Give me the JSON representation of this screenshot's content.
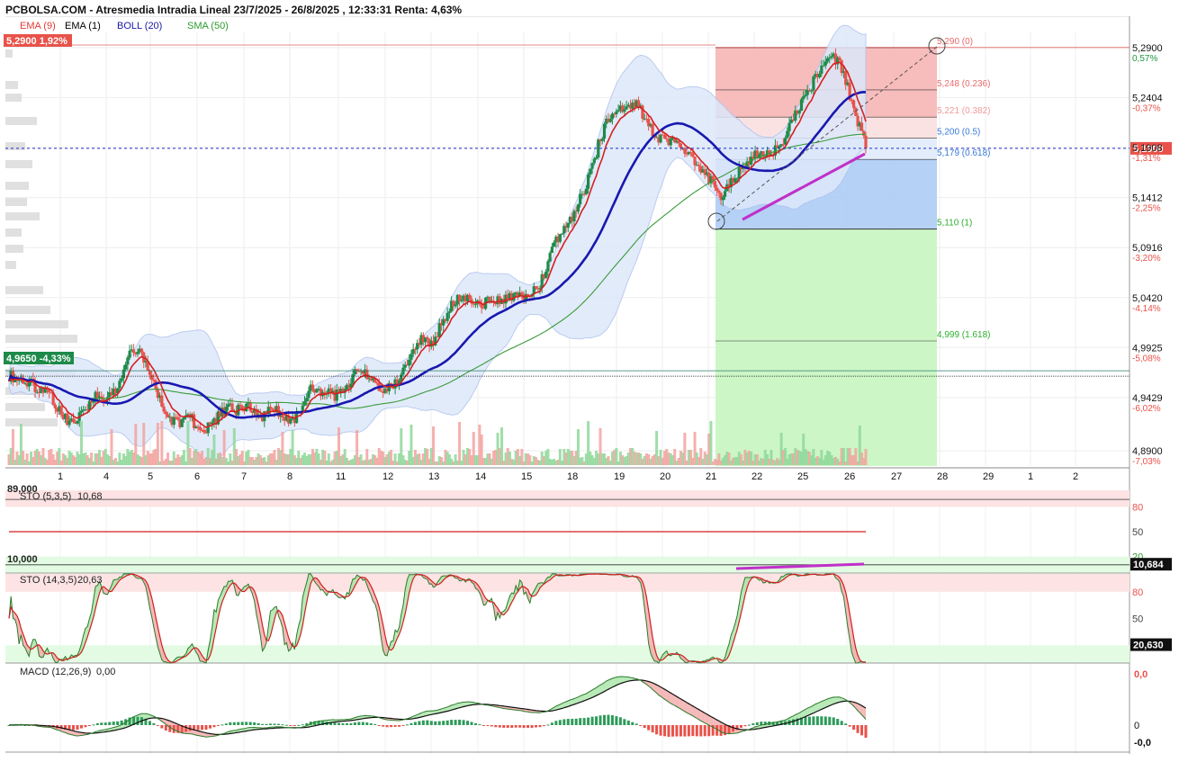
{
  "header": {
    "title": "PCBOLSA.COM - Atresmedia Intradia Lineal 23/7/2025 - 26/8/2025 , 12:33:31 Renta: 4,63%"
  },
  "legend": [
    {
      "label": "EMA (9)",
      "color": "#e53935"
    },
    {
      "label": "EMA (1)",
      "color": "#000000"
    },
    {
      "label": "BOLL (20)",
      "color": "#1a1aa8"
    },
    {
      "label": "SMA (50)",
      "color": "#2e9b2e"
    }
  ],
  "colors": {
    "up": "#1e8a4a",
    "down": "#e8524a",
    "ema9": "#d62020",
    "boll_mid": "#1818b0",
    "boll_band_fill": "#dde8fa",
    "sma50": "#3a9b3a",
    "fib_red": "#f6b5b5",
    "fib_blue": "#a8c9f5",
    "fib_green": "#c6f5c0",
    "trend_magenta": "#c030c8"
  },
  "price_badges": {
    "top": {
      "text": "5,2900 1,92%",
      "color": "#e8524a",
      "value": 5.29
    },
    "left": {
      "text": "4,9650 -4,33%",
      "color": "#1e8a4a",
      "value": 4.965
    },
    "right_current": {
      "text": "5,1900",
      "color": "#e8524a",
      "value": 5.19
    }
  },
  "y_axis_labels": [
    {
      "price": "5,2900",
      "pct": "0,57%",
      "value": 5.29,
      "pct_color": "#1e9a3e"
    },
    {
      "price": "5,2404",
      "pct": "-0,37%",
      "value": 5.2404,
      "pct_color": "#e8524a"
    },
    {
      "price": "5,1908",
      "pct": "-1,31%",
      "value": 5.1908,
      "pct_color": "#e8524a"
    },
    {
      "price": "5,1412",
      "pct": "-2,25%",
      "value": 5.1412,
      "pct_color": "#e8524a"
    },
    {
      "price": "5,0916",
      "pct": "-3,20%",
      "value": 5.0916,
      "pct_color": "#e8524a"
    },
    {
      "price": "5,0420",
      "pct": "-4,14%",
      "value": 5.042,
      "pct_color": "#e8524a"
    },
    {
      "price": "4,9925",
      "pct": "-5,08%",
      "value": 4.9925,
      "pct_color": "#e8524a"
    },
    {
      "price": "4,9429",
      "pct": "-6,02%",
      "value": 4.9429,
      "pct_color": "#e8524a"
    },
    {
      "price": "4,8900",
      "pct": "-7,03%",
      "value": 4.89,
      "pct_color": "#e8524a"
    }
  ],
  "x_axis_labels": [
    "1",
    "4",
    "5",
    "6",
    "7",
    "8",
    "11",
    "12",
    "13",
    "14",
    "15",
    "18",
    "19",
    "20",
    "21",
    "22",
    "25",
    "26",
    "27",
    "28",
    "29",
    "1",
    "2"
  ],
  "fib_levels": [
    {
      "label": "5,290 (0)",
      "value": 5.29,
      "color": "#e86a6a"
    },
    {
      "label": "5,248 (0.236)",
      "value": 5.248,
      "color": "#e86a6a"
    },
    {
      "label": "5,221 (0.382)",
      "value": 5.221,
      "color": "#f09a9a"
    },
    {
      "label": "5,200 (0.5)",
      "value": 5.2,
      "color": "#3a7ad8"
    },
    {
      "label": "5,179 (0.618)",
      "value": 5.179,
      "color": "#3a7ad8"
    },
    {
      "label": "5,110 (1)",
      "value": 5.11,
      "color": "#2eae2e"
    },
    {
      "label": "4,999 (1.618)",
      "value": 4.999,
      "color": "#2eae2e"
    }
  ],
  "sto1": {
    "label": "STO (5,3,5)",
    "value_text": "10,68",
    "level_top_text": "89,000",
    "level_bottom_text": "10,000",
    "ticks": [
      "80",
      "50",
      "20"
    ],
    "badge": "10,684",
    "badge_value": 10.684
  },
  "sto2": {
    "label": "STO (14,3,5)",
    "value_text": "20,63",
    "ticks": [
      "80",
      "50"
    ],
    "badge": "20,630",
    "badge_value": 20.63
  },
  "macd": {
    "label": "MACD (12,26,9)",
    "value_text": "0,00",
    "ticks": {
      "top": "0,0",
      "mid": "0",
      "bottom": "-0,0"
    }
  },
  "chart_data": {
    "type": "candlestick",
    "symbol": "Atresmedia",
    "title": "PCBOLSA.COM - Atresmedia Intradia Lineal 23/7/2025 - 26/8/2025 , 12:33:31 Renta: 4,63%",
    "ylim": [
      4.875,
      5.305
    ],
    "x_categories": [
      "1",
      "4",
      "5",
      "6",
      "7",
      "8",
      "11",
      "12",
      "13",
      "14",
      "15",
      "18",
      "19",
      "20",
      "21",
      "22",
      "25",
      "26"
    ],
    "price_path": [
      [
        "1",
        4.965
      ],
      [
        "1",
        4.96
      ],
      [
        "1",
        4.955
      ],
      [
        "1",
        4.95
      ],
      [
        "4",
        4.935
      ],
      [
        "4",
        4.915
      ],
      [
        "4",
        4.925
      ],
      [
        "4",
        4.945
      ],
      [
        "5",
        4.94
      ],
      [
        "5",
        4.955
      ],
      [
        "5",
        4.99
      ],
      [
        "5",
        4.985
      ],
      [
        "6",
        4.955
      ],
      [
        "6",
        4.925
      ],
      [
        "6",
        4.918
      ],
      [
        "6",
        4.925
      ],
      [
        "7",
        4.905
      ],
      [
        "7",
        4.92
      ],
      [
        "7",
        4.932
      ],
      [
        "7",
        4.93
      ],
      [
        "8",
        4.935
      ],
      [
        "8",
        4.925
      ],
      [
        "8",
        4.932
      ],
      [
        "8",
        4.92
      ],
      [
        "11",
        4.925
      ],
      [
        "11",
        4.955
      ],
      [
        "11",
        4.948
      ],
      [
        "11",
        4.945
      ],
      [
        "12",
        4.955
      ],
      [
        "12",
        4.975
      ],
      [
        "12",
        4.96
      ],
      [
        "12",
        4.95
      ],
      [
        "13",
        4.955
      ],
      [
        "13",
        4.98
      ],
      [
        "13",
        5.0
      ],
      [
        "13",
        4.995
      ],
      [
        "14",
        5.02
      ],
      [
        "14",
        5.04
      ],
      [
        "14",
        5.045
      ],
      [
        "14",
        5.035
      ],
      [
        "15",
        5.04
      ],
      [
        "15",
        5.038
      ],
      [
        "15",
        5.045
      ],
      [
        "15",
        5.04
      ],
      [
        "18",
        5.055
      ],
      [
        "18",
        5.09
      ],
      [
        "18",
        5.11
      ],
      [
        "18",
        5.13
      ],
      [
        "19",
        5.16
      ],
      [
        "19",
        5.2
      ],
      [
        "19",
        5.23
      ],
      [
        "19",
        5.225
      ],
      [
        "20",
        5.235
      ],
      [
        "20",
        5.21
      ],
      [
        "20",
        5.2
      ],
      [
        "20",
        5.195
      ],
      [
        "21",
        5.19
      ],
      [
        "21",
        5.17
      ],
      [
        "21",
        5.16
      ],
      [
        "21",
        5.14
      ],
      [
        "22",
        5.16
      ],
      [
        "22",
        5.175
      ],
      [
        "22",
        5.185
      ],
      [
        "22",
        5.185
      ],
      [
        "25",
        5.195
      ],
      [
        "25",
        5.22
      ],
      [
        "25",
        5.24
      ],
      [
        "25",
        5.265
      ],
      [
        "26",
        5.285
      ],
      [
        "26",
        5.27
      ],
      [
        "26",
        5.23
      ],
      [
        "26",
        5.19
      ]
    ],
    "series": [
      {
        "name": "EMA (9)"
      },
      {
        "name": "BOLL (20)"
      },
      {
        "name": "SMA (50)"
      }
    ],
    "last": 5.19,
    "fib_retracement": {
      "high": 5.29,
      "low": 5.11
    }
  }
}
